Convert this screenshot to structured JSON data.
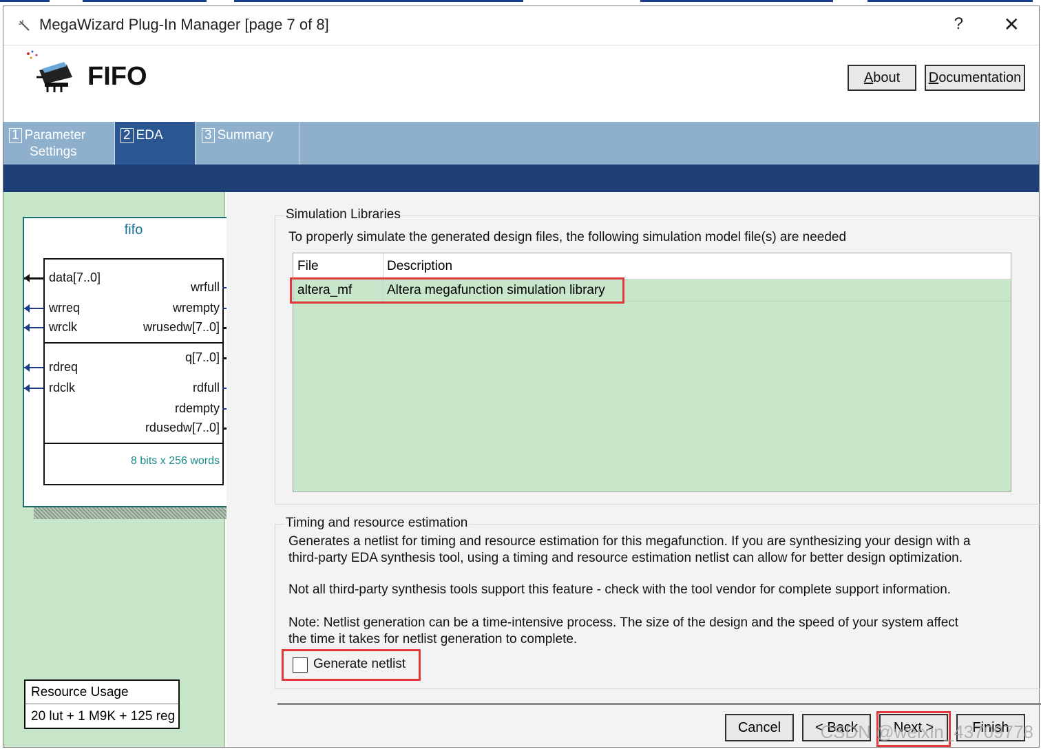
{
  "window": {
    "title": "MegaWizard Plug-In Manager [page 7 of 8]",
    "help_glyph": "?",
    "close_glyph": "✕"
  },
  "header": {
    "product": "FIFO",
    "about_label": "About",
    "about_mnemonic": "A",
    "documentation_label": "Documentation",
    "documentation_mnemonic": "D"
  },
  "tabs": [
    {
      "num": "1",
      "label_line1": "Parameter",
      "label_line2": "Settings",
      "active": false
    },
    {
      "num": "2",
      "label_line1": "EDA",
      "label_line2": "",
      "active": true
    },
    {
      "num": "3",
      "label_line1": "Summary",
      "label_line2": "",
      "active": false
    }
  ],
  "symbol": {
    "name": "fifo",
    "inputs": [
      "data[7..0]",
      "wrreq",
      "wrclk",
      "rdreq",
      "rdclk"
    ],
    "outputs": [
      "wrfull",
      "wrempty",
      "wrusedw[7..0]",
      "q[7..0]",
      "rdfull",
      "rdempty",
      "rdusedw[7..0]"
    ],
    "size_note": "8 bits x 256 words"
  },
  "resource": {
    "header": "Resource Usage",
    "value": "20 lut + 1 M9K + 125 reg"
  },
  "simulation": {
    "group_title": "Simulation Libraries",
    "description": "To properly simulate the generated design files, the following simulation model file(s) are needed",
    "columns": [
      "File",
      "Description"
    ],
    "rows": [
      {
        "file": "altera_mf",
        "description": "Altera megafunction simulation library"
      }
    ]
  },
  "timing": {
    "group_title": "Timing and resource estimation",
    "para1_line1": "Generates a netlist for timing and resource estimation for this megafunction. If you are synthesizing your design with a",
    "para1_line2": "third-party EDA synthesis tool, using a timing and resource estimation netlist can allow for better design optimization.",
    "para2": "Not all third-party synthesis tools support this feature - check with the tool vendor for complete support information.",
    "para3_line1": "Note: Netlist generation can be a time-intensive process. The size of the design and the speed of your system affect",
    "para3_line2": "the time it takes for netlist generation to complete.",
    "checkbox_label": "Generate netlist",
    "checkbox_checked": false
  },
  "footer": {
    "cancel": "Cancel",
    "back": "< Back",
    "next": "Next >",
    "finish": "Finish"
  },
  "watermark": "CSDN @weixin_43709778",
  "colors": {
    "accent_tab": "#2a5791",
    "tabbar": "#8fb0cc",
    "band": "#1d3f75",
    "left_pane": "#c7e5c9",
    "table_bg": "#c8e6c9",
    "highlight": "#e23a3a"
  }
}
